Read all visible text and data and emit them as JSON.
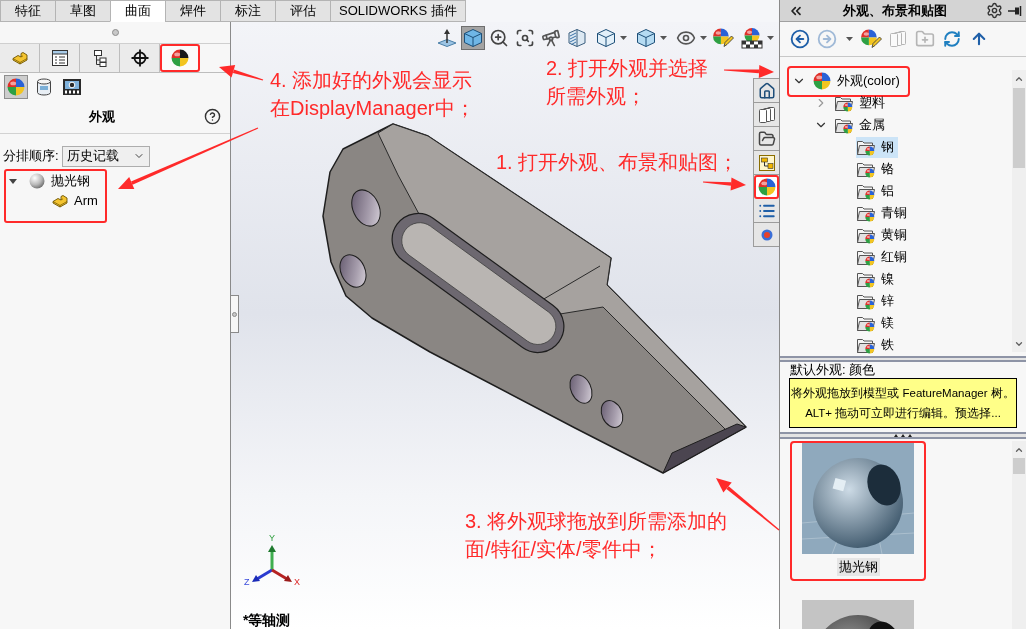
{
  "command_tabs": [
    {
      "label": "特征",
      "selected": false
    },
    {
      "label": "草图",
      "selected": false
    },
    {
      "label": "曲面",
      "selected": true
    },
    {
      "label": "焊件",
      "selected": false
    },
    {
      "label": "标注",
      "selected": false
    },
    {
      "label": "评估",
      "selected": false
    },
    {
      "label": "SOLIDWORKS 插件",
      "selected": false
    }
  ],
  "feature_manager": {
    "tabs": [
      {
        "kind": "feature",
        "selected": false,
        "highlighted": false
      },
      {
        "kind": "property",
        "selected": false,
        "highlighted": false
      },
      {
        "kind": "configuration",
        "selected": false,
        "highlighted": false
      },
      {
        "kind": "dimxpert",
        "selected": false,
        "highlighted": false
      },
      {
        "kind": "display",
        "selected": true,
        "highlighted": true
      }
    ],
    "display_tabs": [
      {
        "kind": "appearance",
        "selected": true
      },
      {
        "kind": "decal",
        "selected": false
      },
      {
        "kind": "scene",
        "selected": false
      }
    ],
    "title": "外观",
    "sort_label": "分排顺序:",
    "sort_value": "历史记载",
    "tree": {
      "highlighted": true,
      "items": [
        {
          "label": "抛光钢",
          "expanded": true,
          "children": [
            {
              "label": "Arm"
            }
          ]
        }
      ]
    }
  },
  "viewport": {
    "toolbar": [
      {
        "kind": "normal",
        "selected": false,
        "dropdown": false
      },
      {
        "kind": "view-cube",
        "selected": true,
        "dropdown": false
      },
      {
        "kind": "zoom-fit",
        "selected": false,
        "dropdown": false
      },
      {
        "kind": "zoom-area",
        "selected": false,
        "dropdown": false
      },
      {
        "kind": "previous-view",
        "selected": false,
        "dropdown": false
      },
      {
        "kind": "section",
        "selected": false,
        "dropdown": false
      },
      {
        "kind": "orientation",
        "selected": false,
        "dropdown": true
      },
      {
        "kind": "display-style",
        "selected": false,
        "dropdown": true
      },
      {
        "kind": "hide-show",
        "selected": false,
        "dropdown": true
      },
      {
        "kind": "edit-appearance",
        "selected": false,
        "dropdown": false
      },
      {
        "kind": "scene",
        "selected": false,
        "dropdown": true
      }
    ],
    "triad": {
      "y": "Y",
      "z": "Z",
      "x": "X"
    },
    "view_name": "*等轴测"
  },
  "task_pane_tabs": [
    {
      "kind": "home",
      "selected": false,
      "highlighted": false
    },
    {
      "kind": "parts",
      "selected": false,
      "highlighted": false
    },
    {
      "kind": "files",
      "selected": false,
      "highlighted": false
    },
    {
      "kind": "explorer",
      "selected": false,
      "highlighted": false
    },
    {
      "kind": "appearance",
      "selected": true,
      "highlighted": true
    },
    {
      "kind": "properties",
      "selected": false,
      "highlighted": false
    },
    {
      "kind": "custom",
      "selected": false,
      "highlighted": false
    }
  ],
  "task_pane": {
    "title": "外观、布景和贴图",
    "toolbar": [
      {
        "kind": "back",
        "disabled": false
      },
      {
        "kind": "forward",
        "disabled": true
      },
      {
        "kind": "menu",
        "disabled": false
      },
      {
        "kind": "edit",
        "disabled": false
      },
      {
        "kind": "add-parts",
        "disabled": true
      },
      {
        "kind": "add-folder",
        "disabled": true
      },
      {
        "kind": "refresh",
        "disabled": false
      },
      {
        "kind": "up",
        "disabled": false
      }
    ],
    "tree": [
      {
        "label": "外观(color)",
        "expanded": true,
        "selected": false,
        "highlighted": true,
        "children": [
          {
            "label": "塑料",
            "expanded": false,
            "selected": false,
            "highlighted": false
          },
          {
            "label": "金属",
            "expanded": true,
            "selected": false,
            "highlighted": false,
            "children": [
              {
                "label": "钢",
                "selected": true,
                "highlighted": false
              },
              {
                "label": "铬",
                "selected": false,
                "highlighted": false
              },
              {
                "label": "铝",
                "selected": false,
                "highlighted": false
              },
              {
                "label": "青铜",
                "selected": false,
                "highlighted": false
              },
              {
                "label": "黄铜",
                "selected": false,
                "highlighted": false
              },
              {
                "label": "红铜",
                "selected": false,
                "highlighted": false
              },
              {
                "label": "镍",
                "selected": false,
                "highlighted": false
              },
              {
                "label": "锌",
                "selected": false,
                "highlighted": false
              },
              {
                "label": "镁",
                "selected": false,
                "highlighted": false
              },
              {
                "label": "铁",
                "selected": false,
                "highlighted": false
              }
            ]
          }
        ]
      }
    ],
    "default_label": "默认外观: 颜色",
    "hint": "将外观拖放到模型或 FeatureManager 树。ALT+ 拖动可立即进行编辑。预选择...",
    "swatches": [
      {
        "label": "抛光钢",
        "highlighted": true
      },
      {
        "highlighted": false
      }
    ]
  },
  "callouts": [
    {
      "lines": [
        "4. 添加好的外观会显示",
        "在DisplayManager中；"
      ]
    },
    {
      "lines": [
        "2. 打开外观并选择",
        "所需外观；"
      ]
    },
    {
      "lines": [
        "1. 打开外观、布景和贴图；"
      ]
    },
    {
      "lines": [
        "3. 将外观球拖放到所需添加的",
        "面/特征/实体/零件中；"
      ]
    }
  ]
}
